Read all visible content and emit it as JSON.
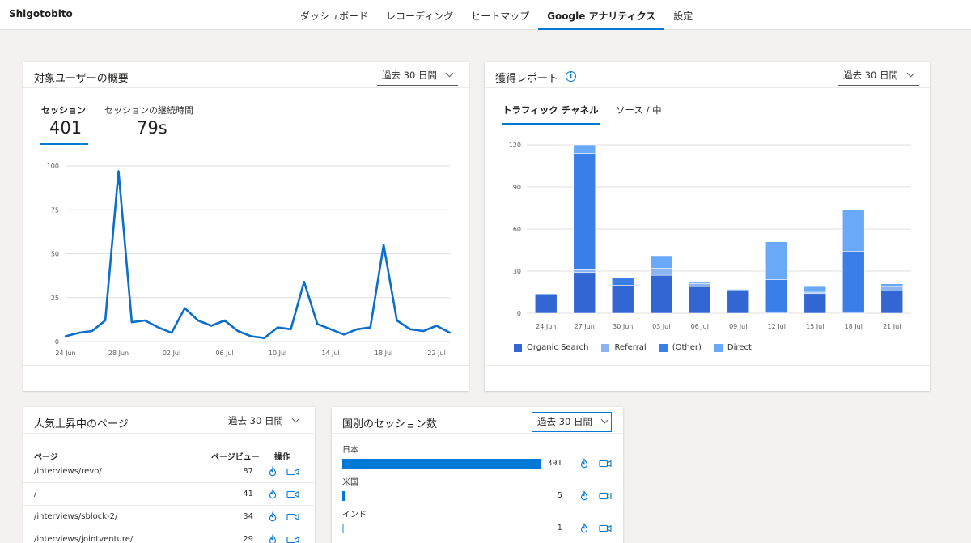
{
  "brand": "Shigotobito",
  "nav": [
    {
      "label": "ダッシュボード",
      "active": false
    },
    {
      "label": "レコーディング",
      "active": false
    },
    {
      "label": "ヒートマップ",
      "active": false
    },
    {
      "label": "Google アナリティクス",
      "active": true
    },
    {
      "label": "設定",
      "active": false
    }
  ],
  "audience": {
    "title": "対象ユーザーの概要",
    "range": "過去 30 日間",
    "metrics": [
      {
        "label": "セッション",
        "value": "401"
      },
      {
        "label": "セッションの継続時間",
        "value": "79s"
      }
    ]
  },
  "acquisition": {
    "title": "獲得レポート",
    "range": "過去 30 日間",
    "tabs": [
      "トラフィック チャネル",
      "ソース / 中"
    ]
  },
  "pages": {
    "title": "人気上昇中のページ",
    "range": "過去 30 日間",
    "col_page": "ページ",
    "col_views": "ページビュー",
    "col_actions": "操作",
    "rows": [
      {
        "page": "/interviews/revo/",
        "views": "87"
      },
      {
        "page": "/",
        "views": "41"
      },
      {
        "page": "/interviews/sblock-2/",
        "views": "34"
      },
      {
        "page": "/interviews/jointventure/",
        "views": "29"
      }
    ]
  },
  "countries": {
    "title": "国別のセッション数",
    "range": "過去 30 日間",
    "rows": [
      {
        "name": "日本",
        "count": "391",
        "value": 391
      },
      {
        "name": "米国",
        "count": "5",
        "value": 5
      },
      {
        "name": "インド",
        "count": "1",
        "value": 1
      }
    ]
  },
  "colors": {
    "accent": "#0078d4",
    "organic": "#3266d3",
    "referral": "#8cb4f2",
    "other": "#3a7ee8",
    "direct": "#6aa8f8"
  },
  "chart_data": [
    {
      "type": "line",
      "x": [
        "24 Jun",
        "25 Jun",
        "26 Jun",
        "27 Jun",
        "28 Jun",
        "29 Jun",
        "30 Jun",
        "01 Jul",
        "02 Jul",
        "03 Jul",
        "04 Jul",
        "05 Jul",
        "06 Jul",
        "07 Jul",
        "08 Jul",
        "09 Jul",
        "10 Jul",
        "11 Jul",
        "12 Jul",
        "13 Jul",
        "14 Jul",
        "15 Jul",
        "16 Jul",
        "17 Jul",
        "18 Jul",
        "19 Jul",
        "20 Jul",
        "21 Jul",
        "22 Jul",
        "23 Jul"
      ],
      "x_ticks": [
        "24 Jun",
        "28 Jun",
        "02 Jul",
        "06 Jul",
        "10 Jul",
        "14 Jul",
        "18 Jul",
        "22 Jul"
      ],
      "series": [
        {
          "values": [
            3,
            5,
            6,
            12,
            97,
            11,
            12,
            8,
            5,
            19,
            12,
            9,
            12,
            6,
            3,
            2,
            8,
            7,
            34,
            10,
            7,
            4,
            7,
            8,
            55,
            12,
            7,
            6,
            9,
            5
          ]
        }
      ],
      "y_ticks": [
        0,
        25,
        50,
        75,
        100
      ],
      "ylim": [
        0,
        100
      ],
      "grid": true
    },
    {
      "type": "bar",
      "stacked": true,
      "categories": [
        "24 Jun",
        "27 Jun",
        "30 Jun",
        "03 Jul",
        "06 Jul",
        "09 Jul",
        "12 Jul",
        "15 Jul",
        "18 Jul",
        "21 Jul"
      ],
      "series": [
        {
          "name": "Organic Search",
          "values": [
            13,
            29,
            20,
            27,
            19,
            16,
            0,
            14,
            0,
            16
          ]
        },
        {
          "name": "Referral",
          "values": [
            1,
            2,
            0,
            5,
            2,
            1,
            1,
            1,
            1,
            3
          ]
        },
        {
          "name": "(Other)",
          "values": [
            0,
            83,
            5,
            0,
            0,
            0,
            23,
            0,
            43,
            0
          ]
        },
        {
          "name": "Direct",
          "values": [
            0,
            6,
            0,
            9,
            1,
            0,
            27,
            4,
            30,
            2
          ]
        }
      ],
      "y_ticks": [
        0,
        30,
        60,
        90,
        120
      ],
      "ylim": [
        0,
        120
      ],
      "legend": "bottom-left",
      "grid": true
    }
  ]
}
